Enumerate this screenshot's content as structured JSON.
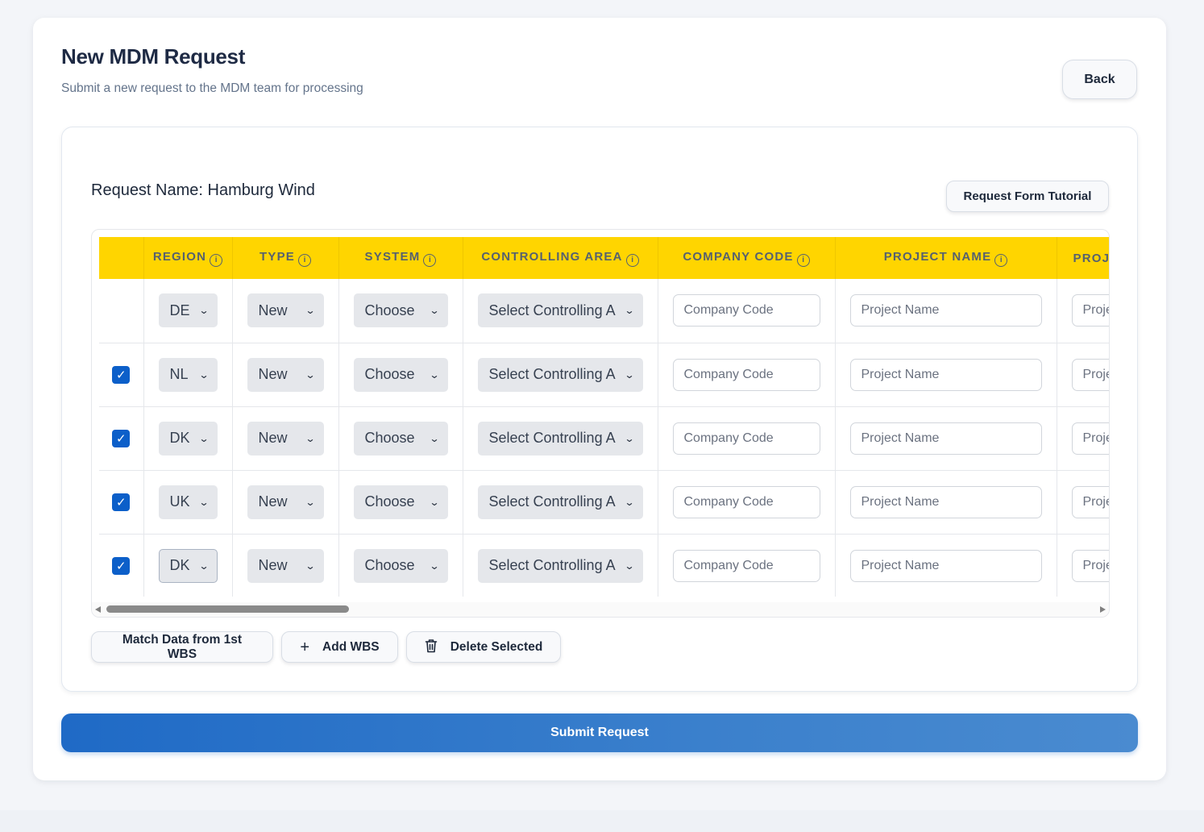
{
  "header": {
    "title": "New MDM Request",
    "subtitle": "Submit a new request to the MDM team for processing",
    "back_label": "Back"
  },
  "form": {
    "request_name": "Request Name: Hamburg Wind",
    "tutorial_label": "Request Form Tutorial"
  },
  "table": {
    "columns": [
      "REGION",
      "TYPE",
      "SYSTEM",
      "CONTROLLING AREA",
      "COMPANY CODE",
      "PROJECT NAME",
      "PROJ"
    ],
    "info_icon": "i",
    "rows": [
      {
        "checked": false,
        "region": "DE",
        "type": "New",
        "system": "Choose",
        "controlling_area": "Select Controlling A",
        "company_code_placeholder": "Company Code",
        "project_name_placeholder": "Project Name",
        "proj_placeholder": "Proje"
      },
      {
        "checked": true,
        "region": "NL",
        "type": "New",
        "system": "Choose",
        "controlling_area": "Select Controlling A",
        "company_code_placeholder": "Company Code",
        "project_name_placeholder": "Project Name",
        "proj_placeholder": "Proje"
      },
      {
        "checked": true,
        "region": "DK",
        "type": "New",
        "system": "Choose",
        "controlling_area": "Select Controlling A",
        "company_code_placeholder": "Company Code",
        "project_name_placeholder": "Project Name",
        "proj_placeholder": "Proje"
      },
      {
        "checked": true,
        "region": "UK",
        "type": "New",
        "system": "Choose",
        "controlling_area": "Select Controlling A",
        "company_code_placeholder": "Company Code",
        "project_name_placeholder": "Project Name",
        "proj_placeholder": "Proje"
      },
      {
        "checked": true,
        "region": "DK",
        "type": "New",
        "system": "Choose",
        "controlling_area": "Select Controlling A",
        "company_code_placeholder": "Company Code",
        "project_name_placeholder": "Project Name",
        "proj_placeholder": "Proje"
      }
    ],
    "horizontal_scroll_fraction": 0.24
  },
  "actions": {
    "match_label": "Match Data from 1st WBS",
    "add_label": "Add WBS",
    "add_icon": "+",
    "delete_label": "Delete Selected",
    "delete_icon": "trash-icon"
  },
  "submit_label": "Submit Request",
  "colors": {
    "header_bg": "#ffd500",
    "checkbox": "#0c5fc9",
    "submit_start": "#1f6ac6",
    "submit_end": "#4a8bd0"
  }
}
